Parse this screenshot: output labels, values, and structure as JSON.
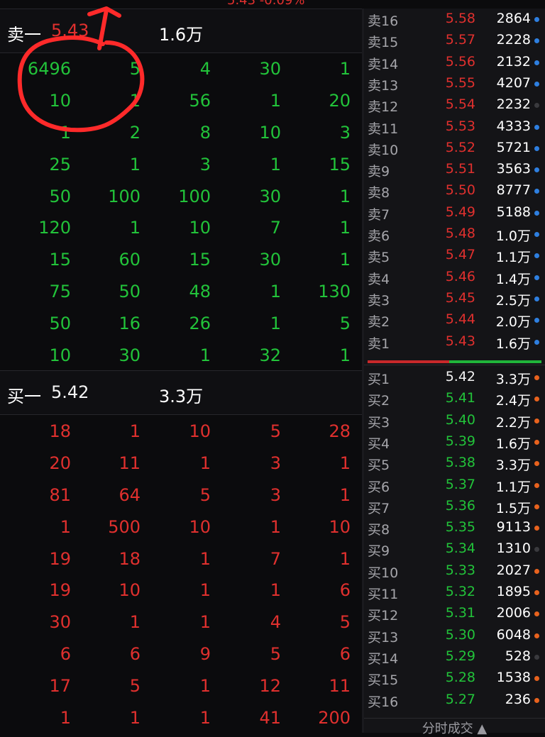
{
  "top_text": "5.43 -0.09%",
  "sell_one": {
    "label": "卖一",
    "price": "5.43",
    "volume": "1.6万"
  },
  "sell_queue": [
    [
      "6496",
      "5",
      "4",
      "30",
      "1"
    ],
    [
      "10",
      "1",
      "56",
      "1",
      "20"
    ],
    [
      "1",
      "2",
      "8",
      "10",
      "3"
    ],
    [
      "25",
      "1",
      "3",
      "1",
      "15"
    ],
    [
      "50",
      "100",
      "100",
      "30",
      "1"
    ],
    [
      "120",
      "1",
      "10",
      "7",
      "1"
    ],
    [
      "15",
      "60",
      "15",
      "30",
      "1"
    ],
    [
      "75",
      "50",
      "48",
      "1",
      "130"
    ],
    [
      "50",
      "16",
      "26",
      "1",
      "5"
    ],
    [
      "10",
      "30",
      "1",
      "32",
      "1"
    ]
  ],
  "buy_one": {
    "label": "买一",
    "price": "5.42",
    "volume": "3.3万"
  },
  "buy_queue": [
    [
      "18",
      "1",
      "10",
      "5",
      "28"
    ],
    [
      "20",
      "11",
      "1",
      "3",
      "1"
    ],
    [
      "81",
      "64",
      "5",
      "3",
      "1"
    ],
    [
      "1",
      "500",
      "10",
      "1",
      "10"
    ],
    [
      "19",
      "18",
      "1",
      "7",
      "1"
    ],
    [
      "19",
      "10",
      "1",
      "1",
      "6"
    ],
    [
      "30",
      "1",
      "1",
      "4",
      "5"
    ],
    [
      "6",
      "6",
      "9",
      "5",
      "6"
    ],
    [
      "17",
      "5",
      "1",
      "12",
      "11"
    ],
    [
      "1",
      "1",
      "1",
      "41",
      "200"
    ]
  ],
  "asks": [
    {
      "label": "卖16",
      "price": "5.58",
      "vol": "2864",
      "dot": "blue"
    },
    {
      "label": "卖15",
      "price": "5.57",
      "vol": "2228",
      "dot": "blue"
    },
    {
      "label": "卖14",
      "price": "5.56",
      "vol": "2132",
      "dot": "blue"
    },
    {
      "label": "卖13",
      "price": "5.55",
      "vol": "4207",
      "dot": "blue"
    },
    {
      "label": "卖12",
      "price": "5.54",
      "vol": "2232",
      "dot": "gray"
    },
    {
      "label": "卖11",
      "price": "5.53",
      "vol": "4333",
      "dot": "blue"
    },
    {
      "label": "卖10",
      "price": "5.52",
      "vol": "5721",
      "dot": "blue"
    },
    {
      "label": "卖9",
      "price": "5.51",
      "vol": "3563",
      "dot": "blue"
    },
    {
      "label": "卖8",
      "price": "5.50",
      "vol": "8777",
      "dot": "blue"
    },
    {
      "label": "卖7",
      "price": "5.49",
      "vol": "5188",
      "dot": "blue"
    },
    {
      "label": "卖6",
      "price": "5.48",
      "vol": "1.0万",
      "dot": "blue"
    },
    {
      "label": "卖5",
      "price": "5.47",
      "vol": "1.1万",
      "dot": "blue"
    },
    {
      "label": "卖4",
      "price": "5.46",
      "vol": "1.4万",
      "dot": "blue"
    },
    {
      "label": "卖3",
      "price": "5.45",
      "vol": "2.5万",
      "dot": "blue"
    },
    {
      "label": "卖2",
      "price": "5.44",
      "vol": "2.0万",
      "dot": "blue"
    },
    {
      "label": "卖1",
      "price": "5.43",
      "vol": "1.6万",
      "dot": "blue"
    }
  ],
  "bids": [
    {
      "label": "买1",
      "price": "5.42",
      "vol": "3.3万",
      "dot": "orange",
      "price_color": "white"
    },
    {
      "label": "买2",
      "price": "5.41",
      "vol": "2.4万",
      "dot": "orange"
    },
    {
      "label": "买3",
      "price": "5.40",
      "vol": "2.2万",
      "dot": "orange"
    },
    {
      "label": "买4",
      "price": "5.39",
      "vol": "1.6万",
      "dot": "orange"
    },
    {
      "label": "买5",
      "price": "5.38",
      "vol": "3.3万",
      "dot": "orange"
    },
    {
      "label": "买6",
      "price": "5.37",
      "vol": "1.1万",
      "dot": "orange"
    },
    {
      "label": "买7",
      "price": "5.36",
      "vol": "1.5万",
      "dot": "orange"
    },
    {
      "label": "买8",
      "price": "5.35",
      "vol": "9113",
      "dot": "orange"
    },
    {
      "label": "买9",
      "price": "5.34",
      "vol": "1310",
      "dot": "gray"
    },
    {
      "label": "买10",
      "price": "5.33",
      "vol": "2027",
      "dot": "orange"
    },
    {
      "label": "买11",
      "price": "5.32",
      "vol": "1895",
      "dot": "orange"
    },
    {
      "label": "买12",
      "price": "5.31",
      "vol": "2006",
      "dot": "orange"
    },
    {
      "label": "买13",
      "price": "5.30",
      "vol": "6048",
      "dot": "orange"
    },
    {
      "label": "买14",
      "price": "5.29",
      "vol": "528",
      "dot": "gray"
    },
    {
      "label": "买15",
      "price": "5.28",
      "vol": "1538",
      "dot": "orange"
    },
    {
      "label": "买16",
      "price": "5.27",
      "vol": "236",
      "dot": "orange"
    }
  ],
  "ratio_split": 0.47,
  "footer_label": "分时成交 ▲",
  "colors": {
    "up_red": "#e0302e",
    "down_green": "#22c33a",
    "blue_dot": "#2e7fe0",
    "orange_dot": "#e8621e",
    "gray_dot": "#3a3a3e",
    "annotation": "#ff2a2a"
  }
}
